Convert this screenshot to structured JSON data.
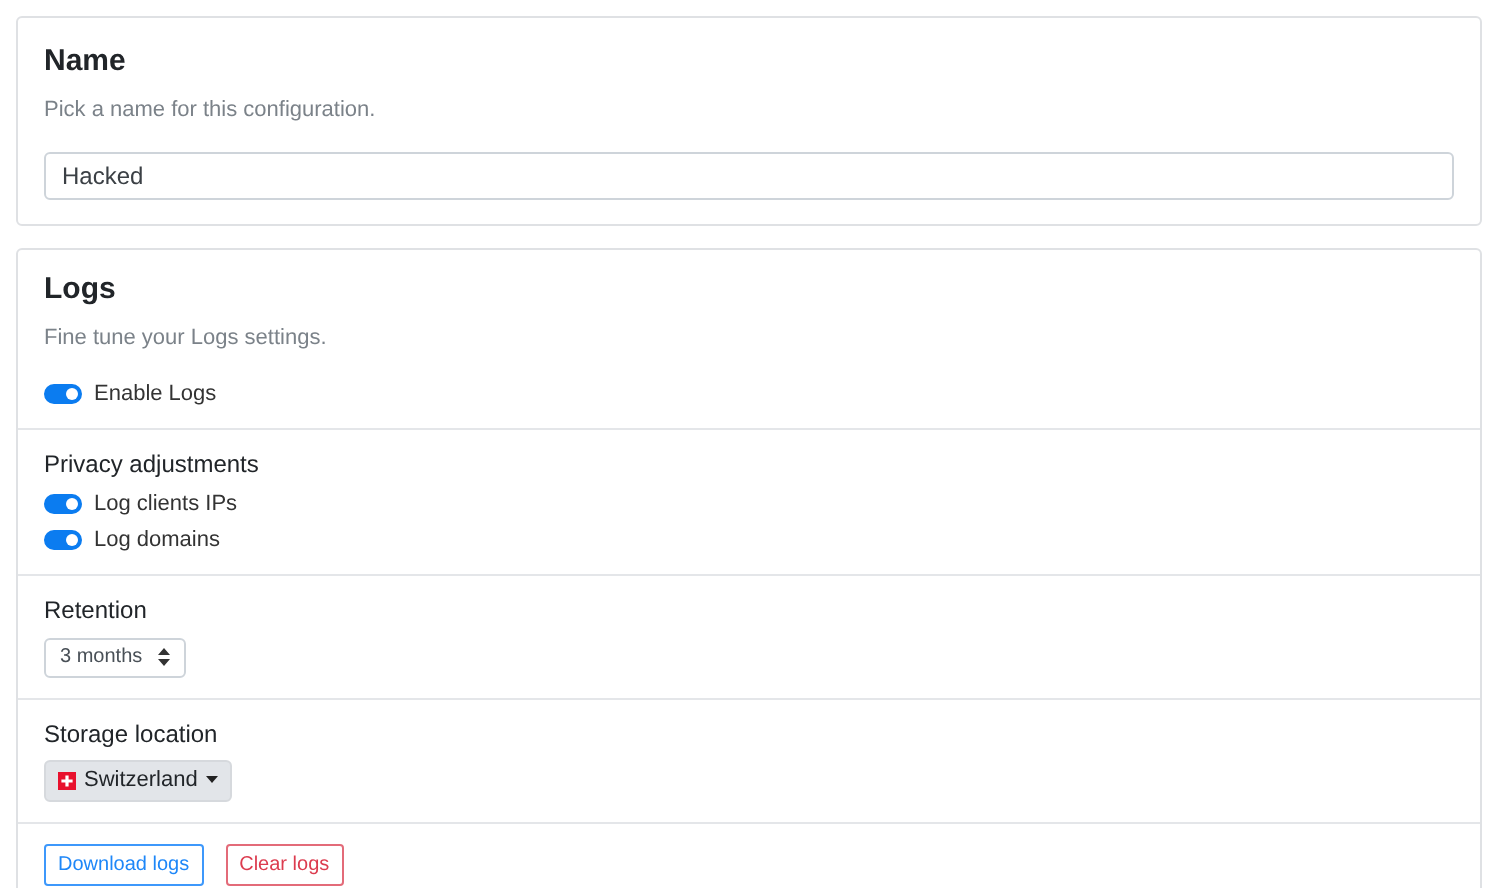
{
  "name_card": {
    "title": "Name",
    "description": "Pick a name for this configuration.",
    "field": {
      "value": "Hacked"
    }
  },
  "logs_card": {
    "title": "Logs",
    "description": "Fine tune your Logs settings.",
    "enable_toggle": {
      "label": "Enable Logs",
      "on": true
    },
    "privacy": {
      "title": "Privacy adjustments",
      "toggles": [
        {
          "label": "Log clients IPs",
          "on": true
        },
        {
          "label": "Log domains",
          "on": true
        }
      ]
    },
    "retention": {
      "title": "Retention",
      "select": {
        "value": "3 months"
      }
    },
    "storage": {
      "title": "Storage location",
      "dropdown": {
        "value": "Switzerland"
      }
    },
    "buttons": [
      {
        "label": "Download logs",
        "kind": "primary"
      },
      {
        "label": "Clear logs",
        "kind": "danger"
      }
    ]
  }
}
